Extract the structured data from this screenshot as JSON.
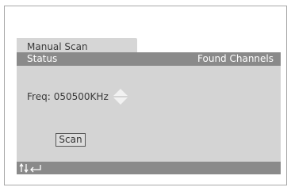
{
  "tab": {
    "label": "Manual Scan"
  },
  "header": {
    "status_label": "Status",
    "found_label": "Found Channels"
  },
  "freq": {
    "label": "Freq:",
    "value": "050500KHz"
  },
  "scan_button": {
    "label": "Scan"
  },
  "footer": {
    "icons": [
      "up-down-arrows-icon",
      "enter-icon"
    ]
  },
  "colors": {
    "tab_bg": "#d6d6d6",
    "header_bg": "#8a8a8a",
    "body_bg": "#d4d4d4",
    "footer_bg": "#8a8a8a"
  }
}
